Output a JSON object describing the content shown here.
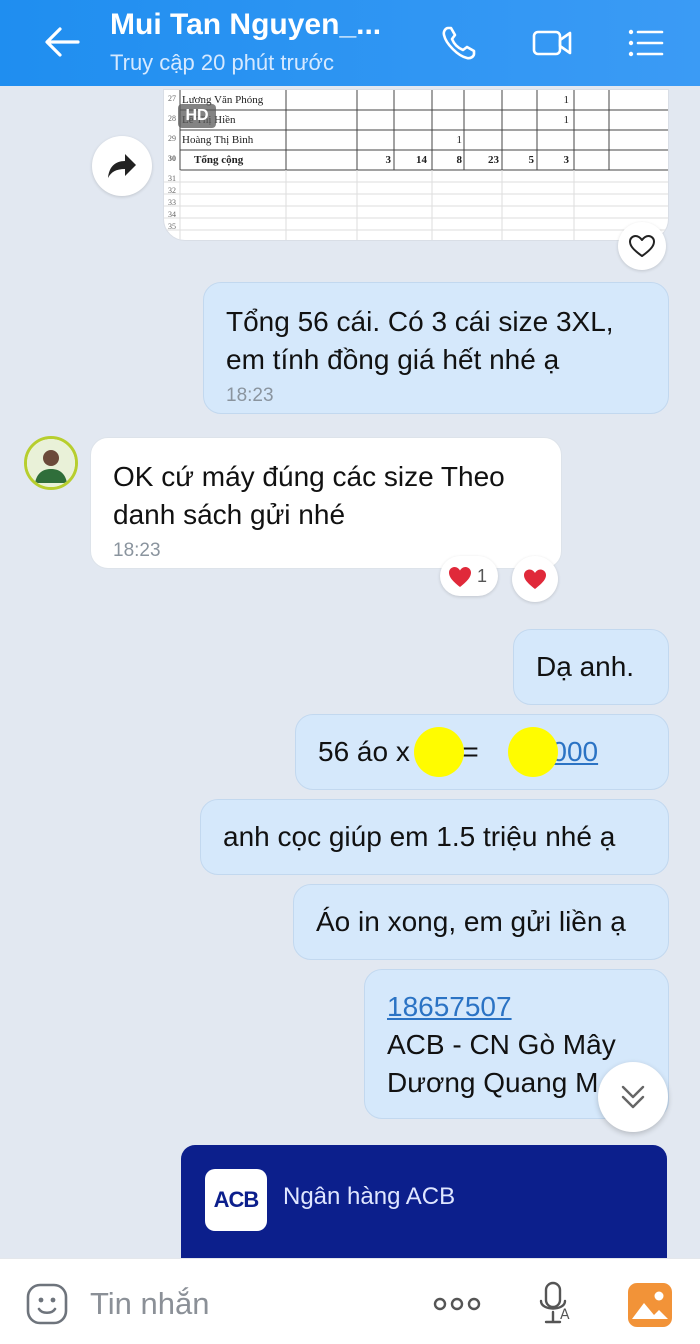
{
  "header": {
    "title": "Mui Tan Nguyen_...",
    "subtitle": "Truy cập 20 phút trước",
    "icons": [
      "back-arrow-icon",
      "phone-icon",
      "video-camera-icon",
      "menu-list-icon"
    ]
  },
  "sheet": {
    "badge": "HD",
    "rows": [
      {
        "num": "27",
        "name": "Lương Văn Phóng",
        "cells": [
          "",
          "",
          "",
          "",
          "",
          "",
          "1",
          ""
        ]
      },
      {
        "num": "28",
        "name": "Lê Thị Hiền",
        "cells": [
          "",
          "",
          "",
          "",
          "",
          "",
          "1",
          ""
        ]
      },
      {
        "num": "29",
        "name": "Hoàng Thị Bình",
        "cells": [
          "",
          "",
          "",
          "1",
          "",
          "",
          "",
          ""
        ]
      },
      {
        "num": "30",
        "name": "Tổng cộng",
        "cells": [
          "",
          "3",
          "14",
          "8",
          "23",
          "5",
          "3",
          ""
        ]
      },
      {
        "num": "31",
        "name": "",
        "cells": []
      },
      {
        "num": "32",
        "name": "",
        "cells": []
      },
      {
        "num": "33",
        "name": "",
        "cells": []
      },
      {
        "num": "34",
        "name": "",
        "cells": []
      },
      {
        "num": "35",
        "name": "",
        "cells": []
      }
    ]
  },
  "messages": {
    "m1": {
      "line1": "Tổng 56 cái. Có 3 cái size 3XL,",
      "line2": "em tính đồng giá hết nhé ạ",
      "time": "18:23"
    },
    "m2": {
      "line1": "OK cứ máy đúng các size Theo",
      "line2": "danh sách gửi nhé",
      "time": "18:23",
      "reaction_count": "1"
    },
    "m3": {
      "text": "Dạ anh."
    },
    "m4": {
      "prefix": "56 áo x",
      "middle": "K = ",
      "link": "60.000"
    },
    "m5": {
      "text": "anh cọc giúp em 1.5 triệu nhé ạ"
    },
    "m6": {
      "text": "Áo in xong, em gửi liền ạ"
    },
    "m7": {
      "account": "18657507",
      "bank": "ACB - CN Gò Mây",
      "name": "Dương Quang M"
    }
  },
  "bank_card": {
    "logo": "ACB",
    "name": "Ngân hàng ACB"
  },
  "composer": {
    "placeholder": "Tin nhắn"
  },
  "colors": {
    "header": "#1f8ef0",
    "my_bubble": "#d5e8fb",
    "bank_card": "#0c1f8c",
    "redaction": "#fffc00"
  }
}
